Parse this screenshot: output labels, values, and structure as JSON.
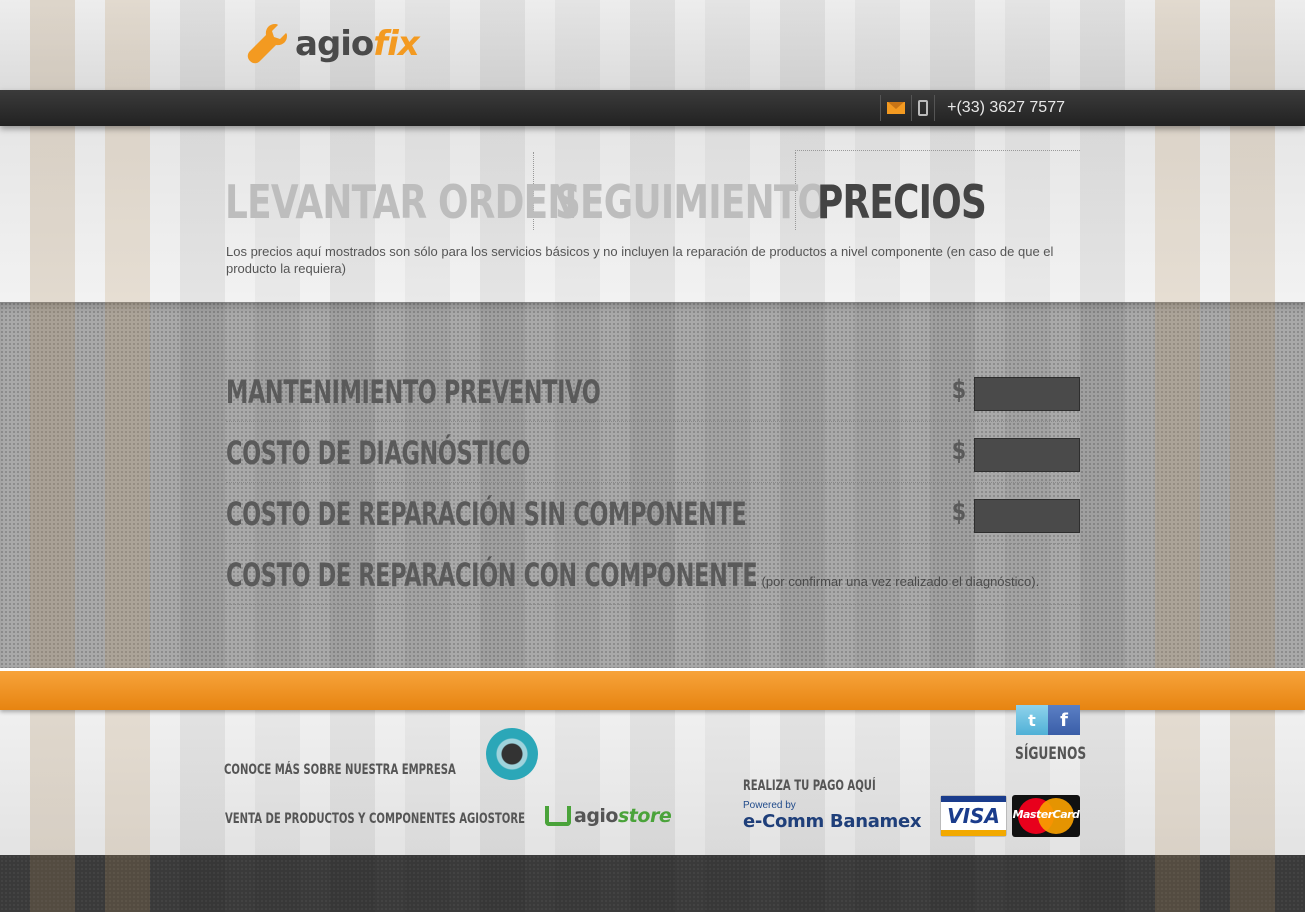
{
  "header": {
    "brand_agio": "agio",
    "brand_fix": "fix",
    "phone": "+(33) 3627 7577"
  },
  "tabs": [
    {
      "label": "LEVANTAR ORDEN",
      "active": false
    },
    {
      "label": "SEGUIMIENTO",
      "active": false
    },
    {
      "label": "PRECIOS",
      "active": true
    }
  ],
  "intro": "Los precios aquí mostrados son sólo para los servicios básicos y no incluyen la reparación de productos a nivel componente (en caso de que el producto la requiera)",
  "prices": {
    "currency_symbol": "$",
    "rows": [
      {
        "label": "MANTENIMIENTO PREVENTIVO",
        "value": ""
      },
      {
        "label": "COSTO DE DIAGNÓSTICO",
        "value": ""
      },
      {
        "label": "COSTO DE REPARACIÓN SIN COMPONENTE",
        "value": ""
      },
      {
        "label": "COSTO DE REPARACIÓN CON COMPONENTE",
        "note": "(por confirmar una vez realizado el diagnóstico)."
      }
    ]
  },
  "footer": {
    "company_link": "CONOCE MÁS SOBRE NUESTRA EMPRESA",
    "store_link": "VENTA DE PRODUCTOS Y COMPONENTES AGIOSTORE",
    "store_brand_agio": "agio",
    "store_brand_store": "store",
    "pay_title": "REALIZA TU PAGO AQUÍ",
    "powered_by": "Powered by",
    "bank": "e-Comm Banamex",
    "visa": "VISA",
    "mastercard": "MasterCard",
    "follow": "SÍGUENOS",
    "twitter_glyph": "t",
    "facebook_glyph": "f"
  },
  "colors": {
    "accent": "#f39a21",
    "dark_bar": "#2a2a2a",
    "mid_gray": "#a9a9a9"
  }
}
